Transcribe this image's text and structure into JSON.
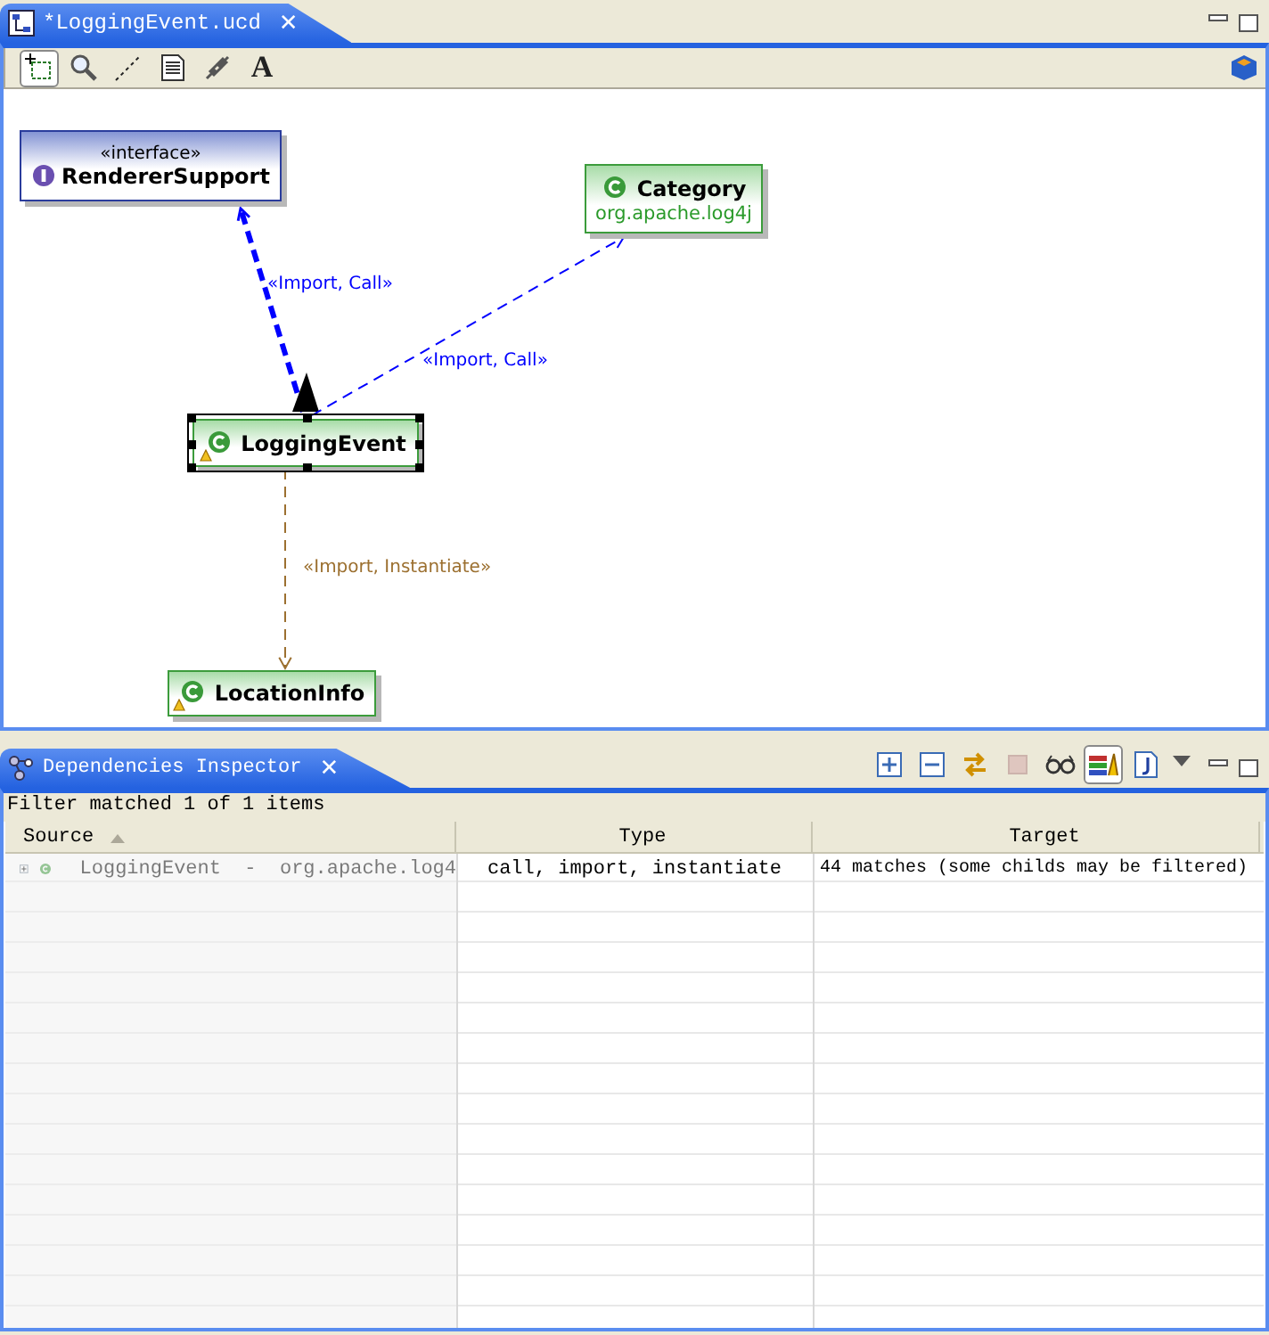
{
  "editor": {
    "tab_title": "*LoggingEvent.ucd",
    "close_glyph": "✕",
    "tools": [
      {
        "kind": "marquee",
        "selected": true
      },
      {
        "kind": "zoom",
        "selected": false
      },
      {
        "kind": "connection",
        "selected": false
      },
      {
        "kind": "note",
        "selected": false
      },
      {
        "kind": "link",
        "selected": false
      },
      {
        "kind": "text",
        "glyph": "A",
        "selected": false
      }
    ]
  },
  "diagram": {
    "nodes": [
      {
        "kind": "interface",
        "stereotype": "«interface»",
        "name": "RendererSupport",
        "selected": false
      },
      {
        "kind": "class",
        "name": "Category",
        "package": "org.apache.log4j",
        "selected": false
      },
      {
        "kind": "class",
        "name": "LoggingEvent",
        "selected": true,
        "warning": true
      },
      {
        "kind": "class",
        "name": "LocationInfo",
        "selected": false,
        "warning": true
      }
    ],
    "edges": [
      {
        "label": "«Import, Call»",
        "color": "#0000ff",
        "emphasized": true
      },
      {
        "label": "«Import, Call»",
        "color": "#0000ff",
        "emphasized": false
      },
      {
        "label": "«Import, Instantiate»",
        "color": "#9c7030",
        "emphasized": false
      }
    ]
  },
  "inspector": {
    "tab_title": "Dependencies Inspector",
    "close_glyph": "✕",
    "filter_status": "Filter matched 1 of 1 items",
    "toggles": [
      {
        "kind": "expand-all",
        "selected": false,
        "disabled": false
      },
      {
        "kind": "collapse-all",
        "selected": false,
        "disabled": false
      },
      {
        "kind": "sync",
        "selected": false,
        "disabled": false
      },
      {
        "kind": "stop",
        "selected": false,
        "disabled": true
      },
      {
        "kind": "glasses",
        "selected": false,
        "disabled": false
      },
      {
        "kind": "books",
        "selected": true,
        "disabled": false
      },
      {
        "kind": "java",
        "selected": false,
        "disabled": false
      }
    ],
    "columns": [
      {
        "label": "Source",
        "sorted": true
      },
      {
        "label": "Type",
        "sorted": false
      },
      {
        "label": "Target",
        "sorted": false
      }
    ],
    "rows": [
      {
        "expanded": false,
        "source": "LoggingEvent  -  org.apache.log4",
        "type": "call, import, instantiate",
        "target": "44 matches (some childs may be filtered)"
      }
    ]
  }
}
